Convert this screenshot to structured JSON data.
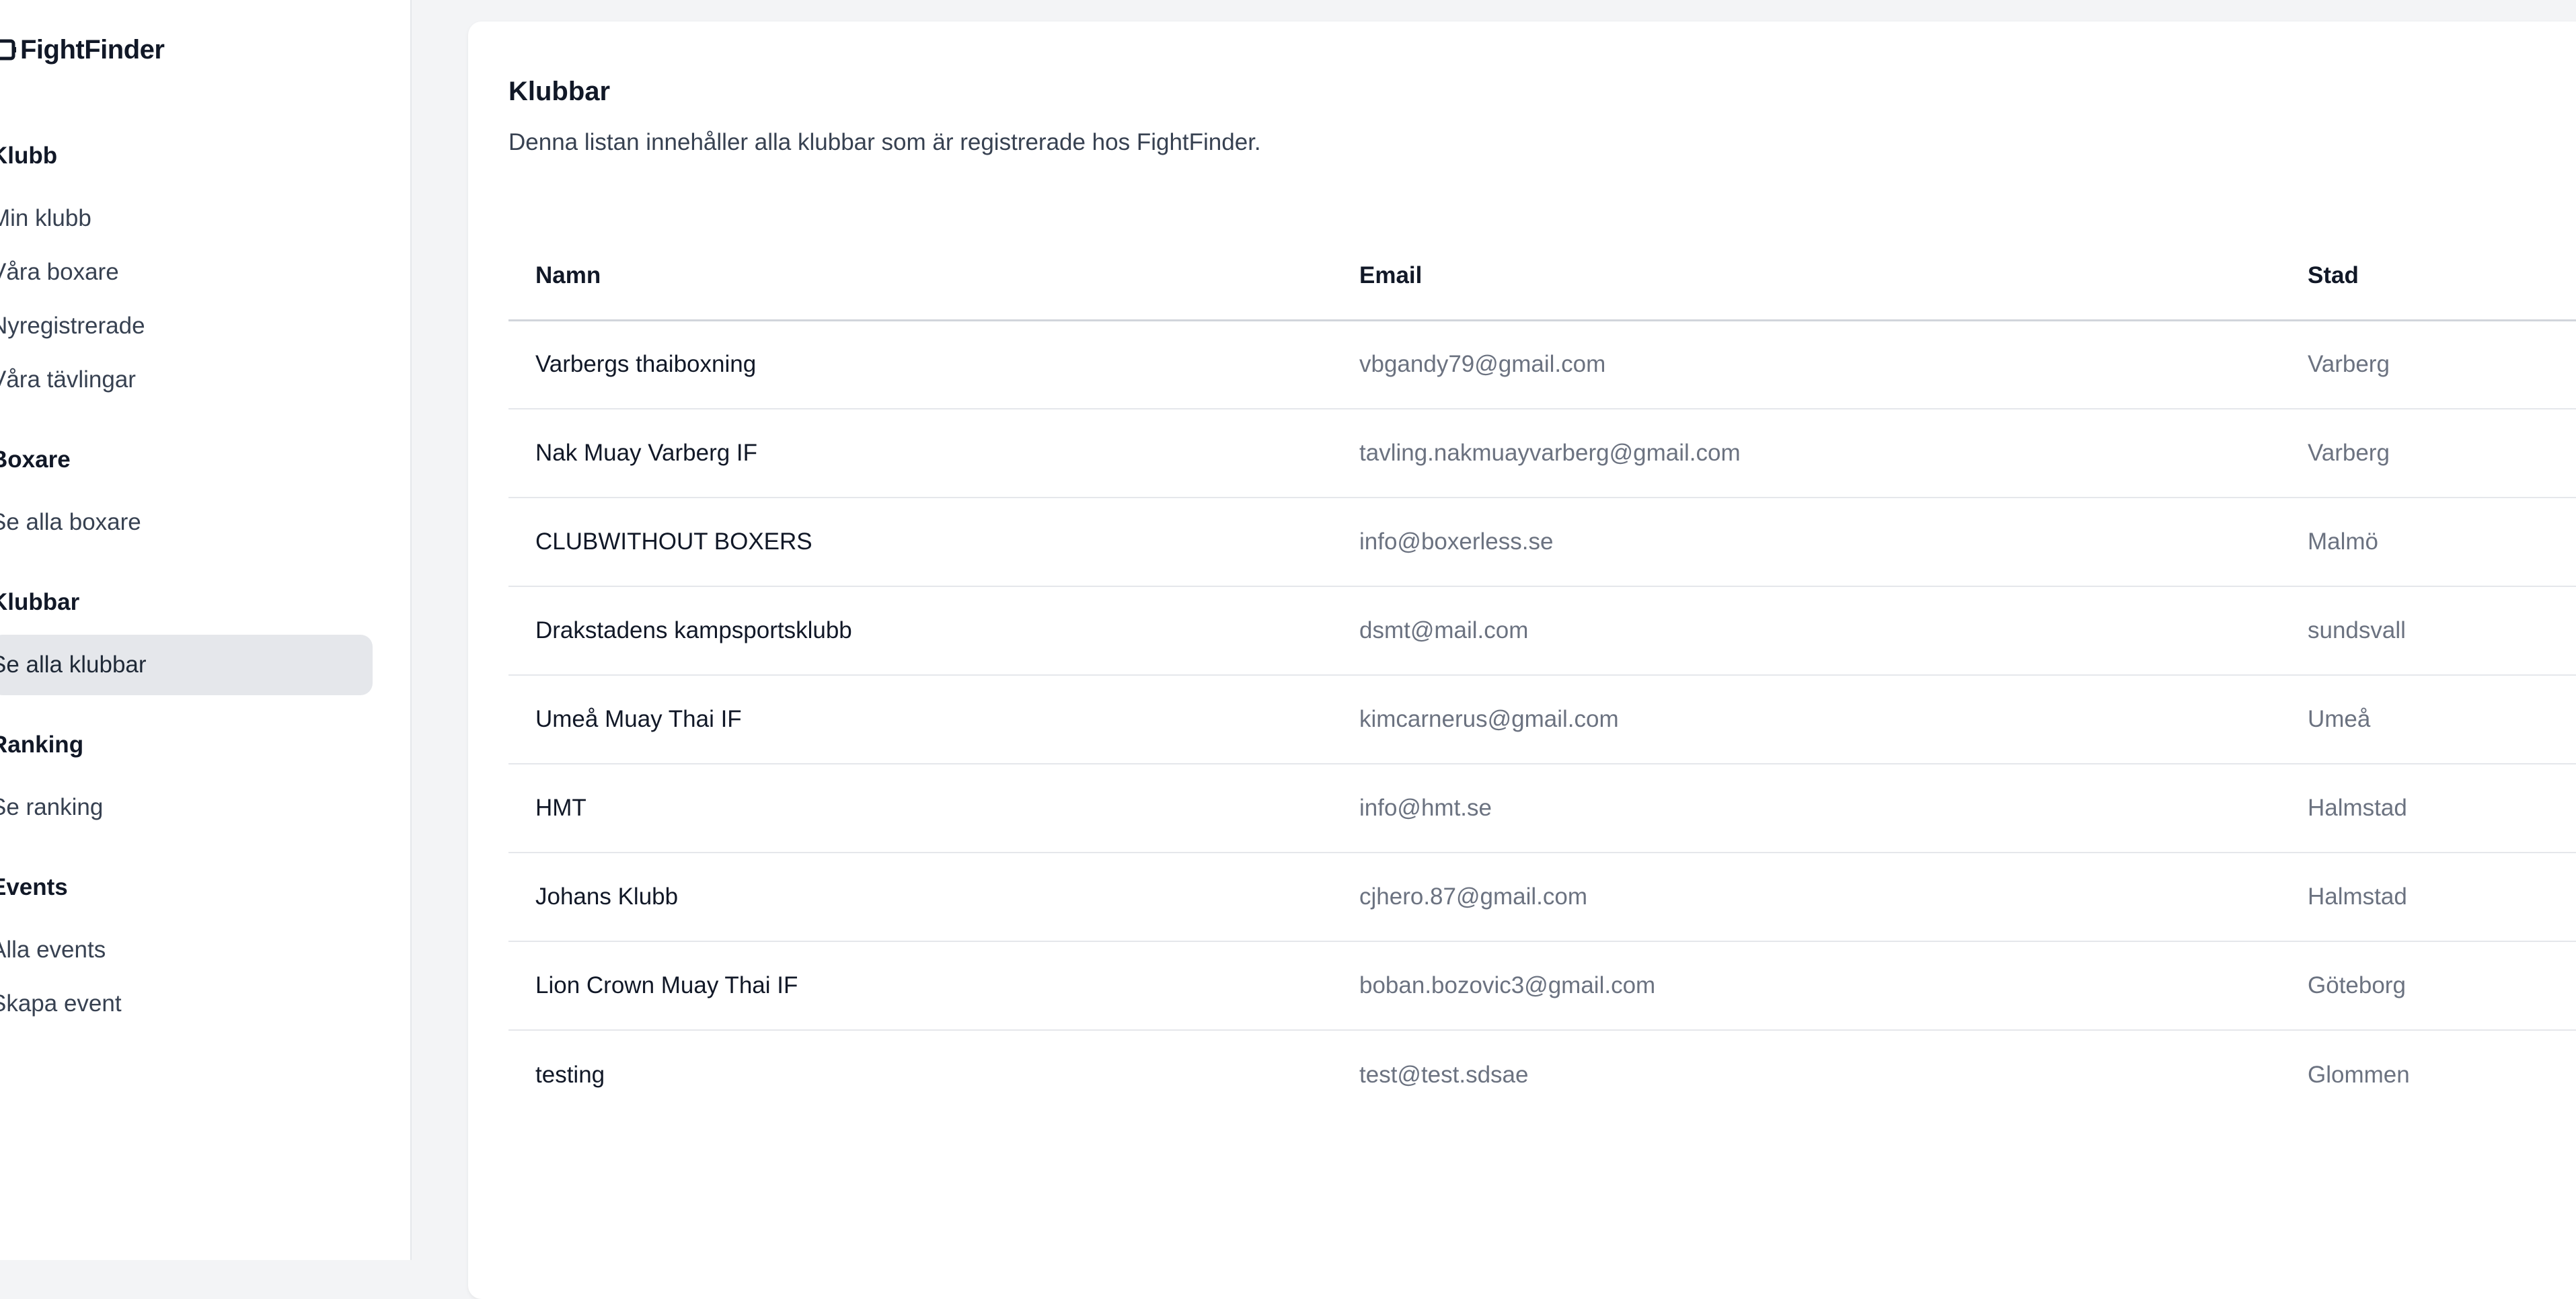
{
  "app": {
    "name": "FightFinder"
  },
  "sidebar": {
    "groups": [
      {
        "title": "Klubb",
        "items": [
          "Min klubb",
          "Våra boxare",
          "Nyregistrerade",
          "Våra tävlingar"
        ]
      },
      {
        "title": "Boxare",
        "items": [
          "Se alla boxare"
        ]
      },
      {
        "title": "Klubbar",
        "items": [
          "Se alla klubbar"
        ]
      },
      {
        "title": "Ranking",
        "items": [
          "Se ranking"
        ]
      },
      {
        "title": "Events",
        "items": [
          "Alla events",
          "Skapa event"
        ]
      }
    ],
    "active_item": "Se alla klubbar"
  },
  "main": {
    "title": "Klubbar",
    "subtitle": "Denna listan innehåller alla klubbar som är registrerade hos FightFinder.",
    "table": {
      "headers": [
        "Namn",
        "Email",
        "Stad"
      ],
      "rows": [
        [
          "Varbergs thaiboxning",
          "vbgandy79@gmail.com",
          "Varberg"
        ],
        [
          "Nak Muay Varberg IF",
          "tavling.nakmuayvarberg@gmail.com",
          "Varberg"
        ],
        [
          "CLUBWITHOUT BOXERS",
          "info@boxerless.se",
          "Malmö"
        ],
        [
          "Drakstadens kampsportsklubb",
          "dsmt@mail.com",
          "sundsvall"
        ],
        [
          "Umeå Muay Thai IF",
          "kimcarnerus@gmail.com",
          "Umeå"
        ],
        [
          "HMT",
          "info@hmt.se",
          "Halmstad"
        ],
        [
          "Johans Klubb",
          "cjhero.87@gmail.com",
          "Halmstad"
        ],
        [
          "Lion Crown Muay Thai IF",
          "boban.bozovic3@gmail.com",
          "Göteborg"
        ],
        [
          "testing",
          "test@test.sdsae",
          "Glommen"
        ]
      ]
    }
  }
}
